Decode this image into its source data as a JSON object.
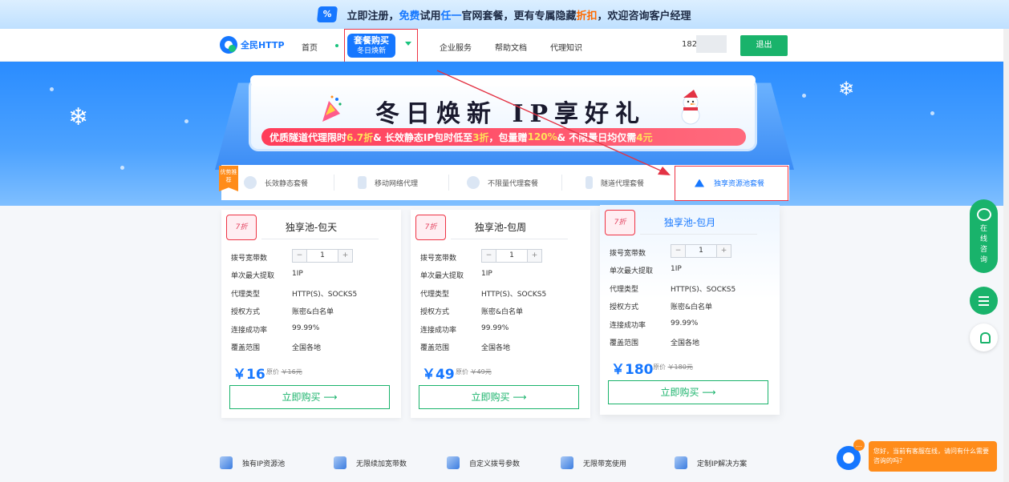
{
  "promo": {
    "icon": "%",
    "parts": [
      "立即注册，",
      "免费",
      "试用",
      "任一",
      "官网套餐，更有专属隐藏",
      "折扣",
      "，欢迎咨询客户经理"
    ]
  },
  "nav": {
    "logo": "全民HTTP",
    "home": "首页",
    "package_title": "套餐购买",
    "package_sub": "冬日焕新",
    "enterprise": "企业服务",
    "docs": "帮助文档",
    "knowledge": "代理知识",
    "phone_prefix": "182",
    "logout": "退出"
  },
  "hero": {
    "title": "冬日焕新 IP享好礼",
    "bar_parts": [
      "优质隧道代理限时",
      "6.7折",
      " & 长效静态IP包时低至",
      "3折",
      "，包量赠",
      "120%",
      " & 不限量日均仅需",
      "4元"
    ]
  },
  "tabs": {
    "badge": "优势推荐",
    "items": [
      "长效静态套餐",
      "移动网络代理",
      "不限量代理套餐",
      "隧道代理套餐",
      "独享资源池套餐"
    ]
  },
  "labels": {
    "bandwidth": "拨号宽带数",
    "max_fetch": "单次最大提取",
    "proxy_type": "代理类型",
    "auth": "授权方式",
    "success_rate": "连接成功率",
    "coverage": "覆盖范围",
    "orig_prefix": "原价",
    "buy": "立即购买",
    "minus": "−",
    "plus": "+"
  },
  "cards": [
    {
      "discount": "7折",
      "title": "独享池-包天",
      "qty": "1",
      "max_fetch": "1IP",
      "proxy_type": "HTTP(S)、SOCKS5",
      "auth": "账密&白名单",
      "success_rate": "99.99%",
      "coverage": "全国各地",
      "price": "￥16",
      "orig": "￥16元"
    },
    {
      "discount": "7折",
      "title": "独享池-包周",
      "qty": "1",
      "max_fetch": "1IP",
      "proxy_type": "HTTP(S)、SOCKS5",
      "auth": "账密&白名单",
      "success_rate": "99.99%",
      "coverage": "全国各地",
      "price": "￥49",
      "orig": "￥49元"
    },
    {
      "discount": "7折",
      "title": "独享池-包月",
      "qty": "1",
      "max_fetch": "1IP",
      "proxy_type": "HTTP(S)、SOCKS5",
      "auth": "账密&白名单",
      "success_rate": "99.99%",
      "coverage": "全国各地",
      "price": "￥180",
      "orig": "￥180元"
    }
  ],
  "features": [
    "独有IP资源池",
    "无限续加宽带数",
    "自定义拨号参数",
    "无限带宽使用",
    "定制IP解决方案"
  ],
  "float": {
    "chat": [
      "在",
      "线",
      "咨",
      "询"
    ]
  },
  "cs": {
    "dot": "…",
    "message": "您好，当前有客服在线，请问有什么需要咨询的吗？"
  },
  "colors": {
    "brand": "#1677ff",
    "green": "#19b36b",
    "annotation": "#e33344",
    "orange": "#ff8c1a"
  }
}
